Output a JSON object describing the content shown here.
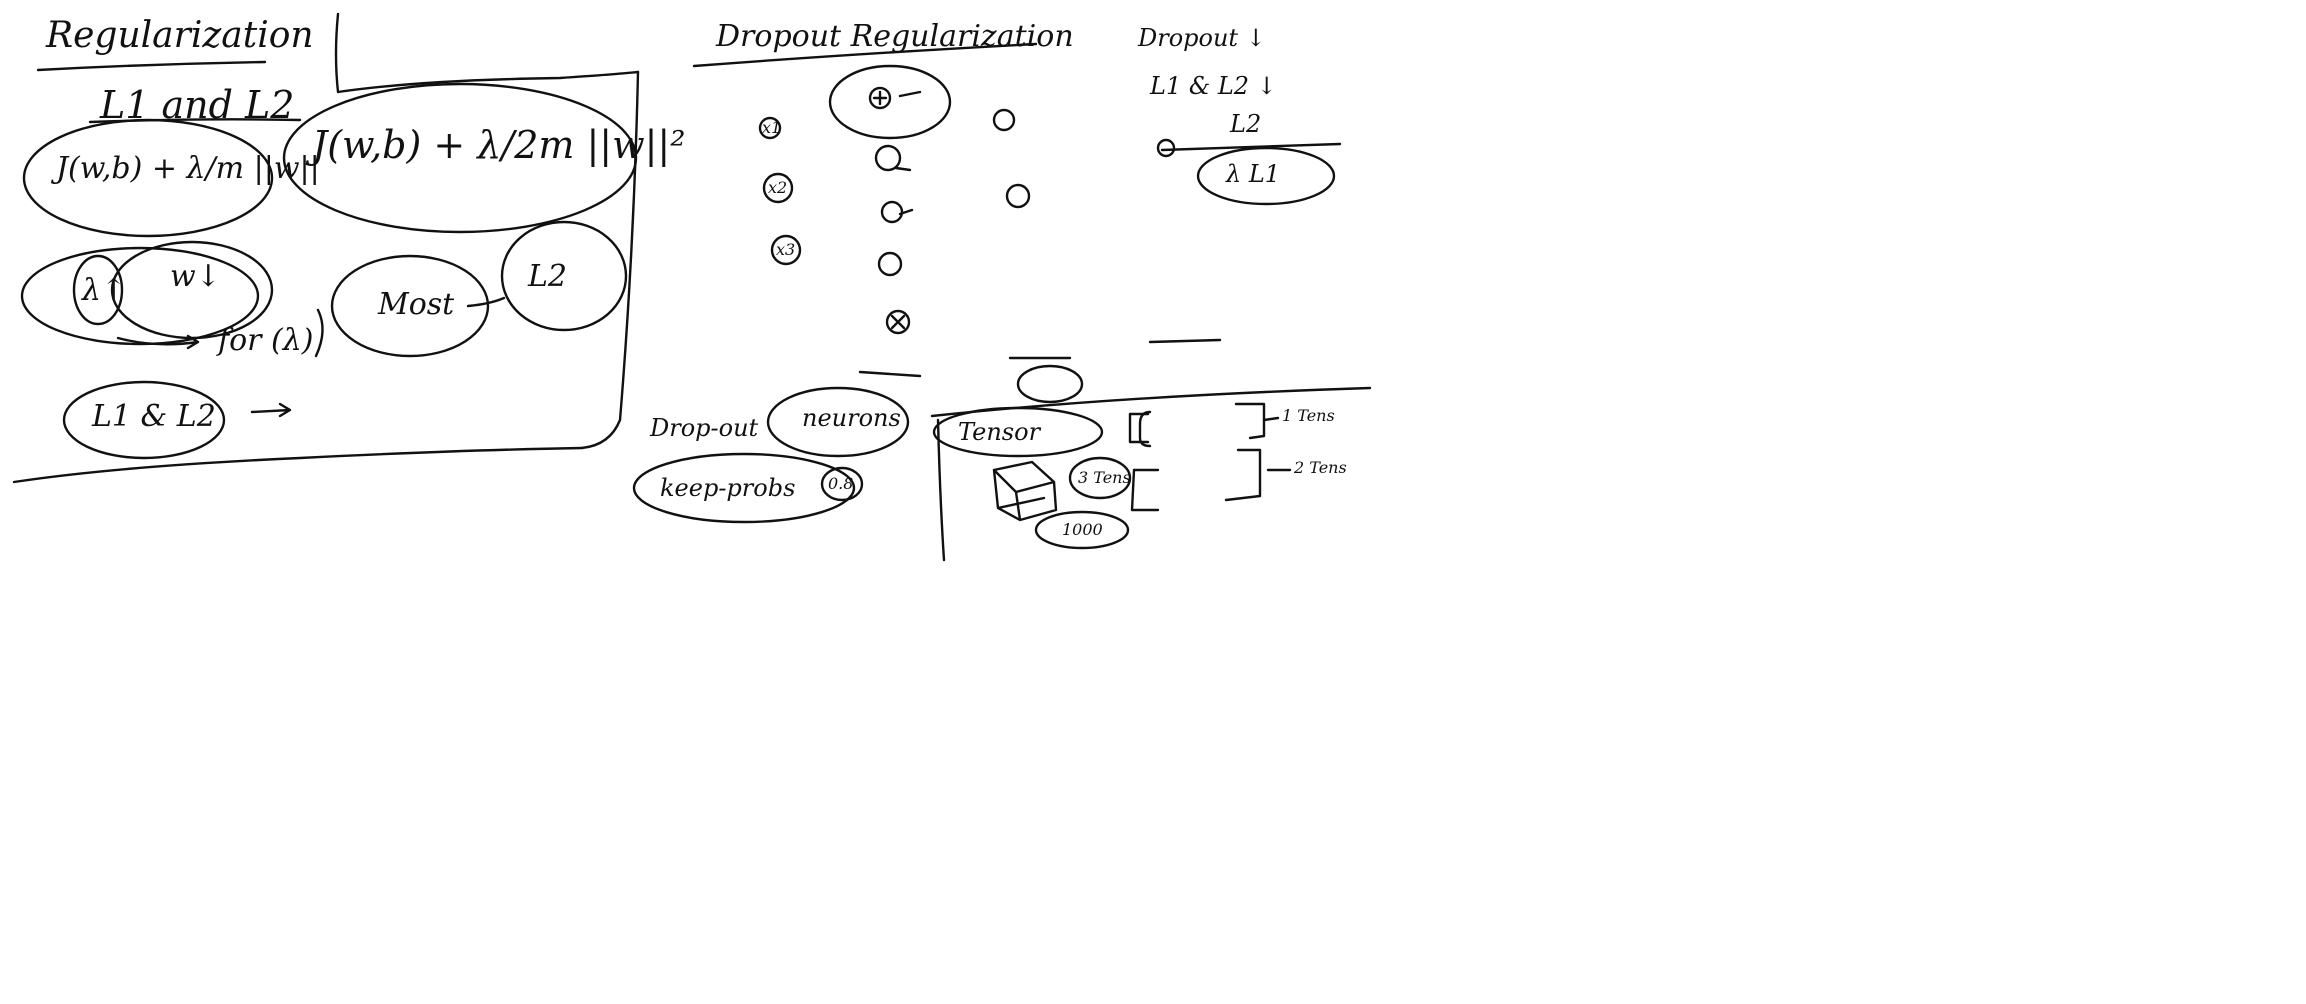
{
  "colors": {
    "ink": "#111111",
    "background": "#ffffff"
  },
  "left_panel": {
    "title": "Regularization",
    "subtitle": "L1 and L2",
    "formula_l1": "J(w,b) + λ/m ||w||",
    "formula_l2": "J(w,b) + λ/2m ||w||²",
    "lambda_label": "λ↑",
    "w_down": "w↓",
    "for_lambda": "for (λ)",
    "most": "Most",
    "l2_circled": "L2",
    "l1_l2": "L1 & L2"
  },
  "middle_panel": {
    "title": "Dropout Regularization",
    "neuron_labels": [
      "x1",
      "x2",
      "x3"
    ],
    "dropout_label": "Drop-out",
    "neurons_label": "neurons",
    "keep_probs_label": "keep-probs",
    "keep_probs_value": "0.8"
  },
  "right_panel": {
    "title": "Dropout ↓",
    "l1_l2": "L1 & L2 ↓",
    "l2_label": "L2",
    "l1_circled": "λ L1"
  },
  "tensor_panel": {
    "tensor_label": "Tensor",
    "one_tensor": "1 Tens",
    "two_tensor": "2 Tens",
    "three_tensor": "3 Tens",
    "thousand": "1000"
  }
}
